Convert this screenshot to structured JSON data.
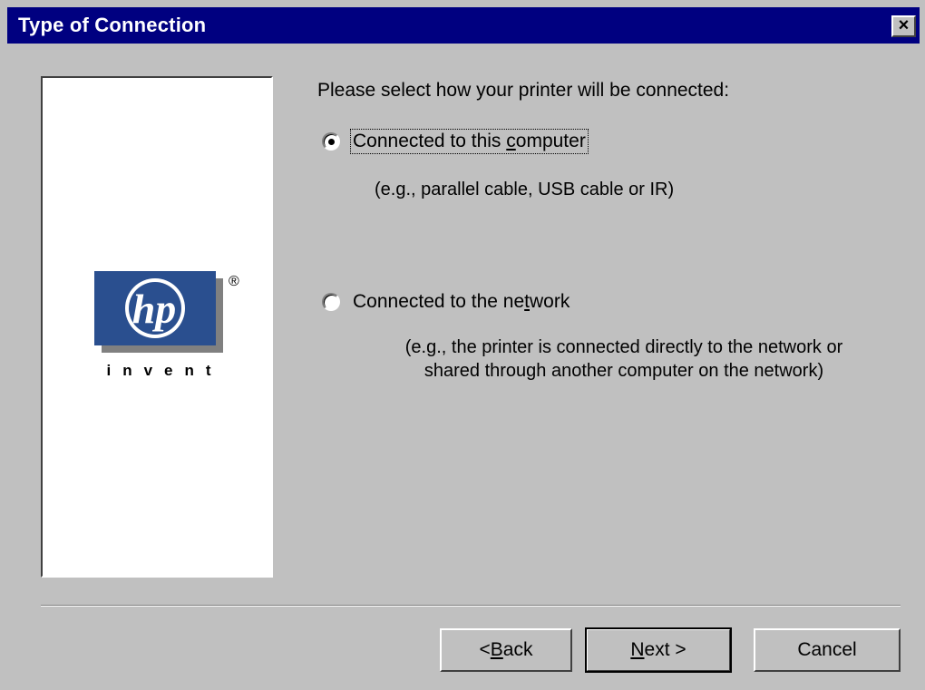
{
  "window": {
    "title": "Type of Connection",
    "close_glyph": "×"
  },
  "logo": {
    "brand": "hp",
    "registered": "®",
    "tagline": "invent",
    "brand_color": "#2a4f8f"
  },
  "prompt": "Please select how your printer will be connected:",
  "options": [
    {
      "label_pre": "Connected to this ",
      "label_access": "c",
      "label_post": "omputer",
      "description": "(e.g., parallel cable, USB cable or IR)",
      "selected": true
    },
    {
      "label_pre": "Connected to the ne",
      "label_access": "t",
      "label_post": "work",
      "description_line1": "(e.g., the printer is connected directly to the network or",
      "description_line2": "shared through another computer on the network)",
      "selected": false
    }
  ],
  "buttons": {
    "back_pre": "< ",
    "back_access": "B",
    "back_post": "ack",
    "next_access": "N",
    "next_post": "ext >",
    "cancel": "Cancel"
  }
}
